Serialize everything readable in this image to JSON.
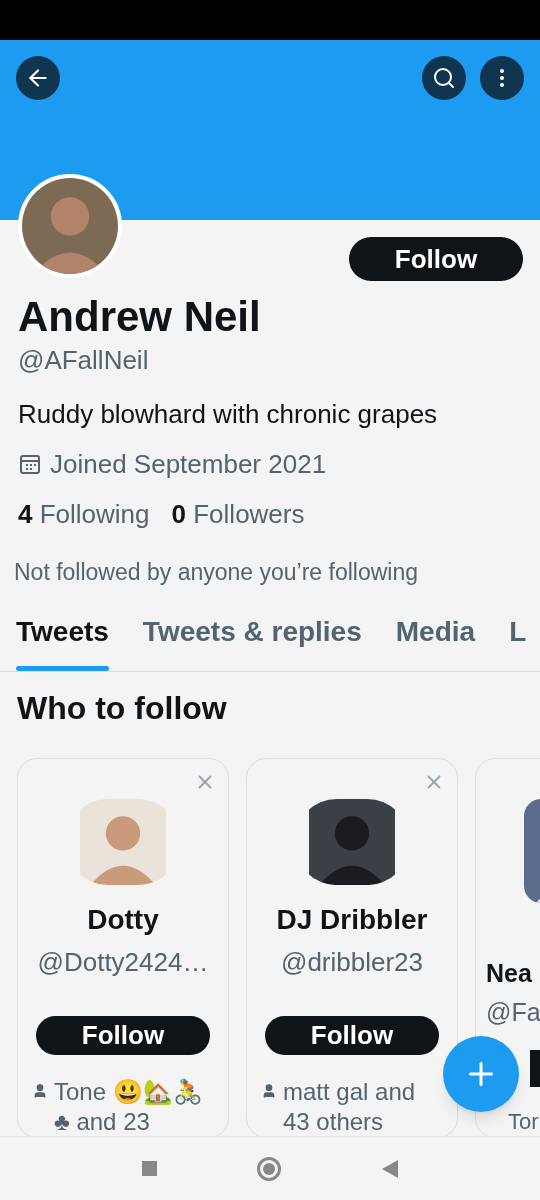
{
  "profile": {
    "name": "Andrew Neil",
    "handle": "@AFallNeil",
    "bio": "Ruddy blowhard with chronic grapes",
    "joined": "Joined September 2021",
    "following_count": "4",
    "following_label": "Following",
    "followers_count": "0",
    "followers_label": "Followers",
    "follow_button": "Follow",
    "mutual_note": "Not followed by anyone you’re following"
  },
  "tabs": [
    {
      "label": "Tweets",
      "selected": true
    },
    {
      "label": "Tweets & replies",
      "selected": false
    },
    {
      "label": "Media",
      "selected": false
    },
    {
      "label": "L",
      "selected": false
    }
  ],
  "who_to_follow": {
    "title": "Who to follow",
    "cards": [
      {
        "kind": "full",
        "name": "Dotty",
        "handle": "@Dotty2424…",
        "button": "Follow",
        "social": "Tone 😃🏡🚴 ♣ and 23"
      },
      {
        "kind": "full",
        "name": "DJ Dribbler",
        "handle": "@dribbler23",
        "button": "Follow",
        "social": "matt gal and 43 others"
      },
      {
        "kind": "partial",
        "name": "Nea",
        "handle": "@Fa",
        "social": "Tor"
      }
    ]
  }
}
